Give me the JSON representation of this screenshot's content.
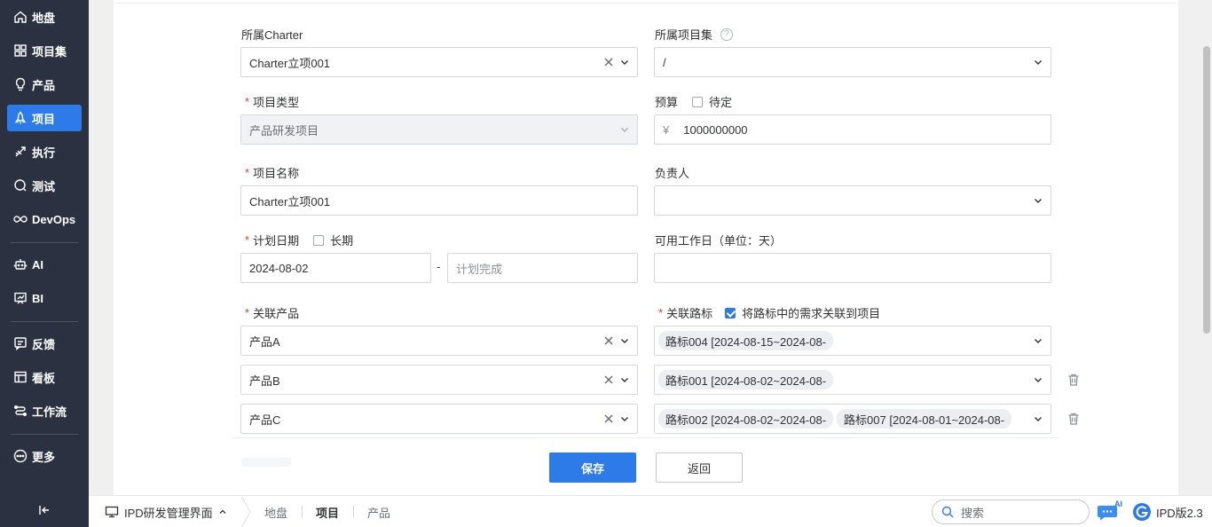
{
  "sidebar": {
    "items": [
      {
        "label": "地盘",
        "icon": "home-icon"
      },
      {
        "label": "项目集",
        "icon": "grid-icon"
      },
      {
        "label": "产品",
        "icon": "bulb-icon"
      },
      {
        "label": "项目",
        "icon": "rocket-icon",
        "active": true
      },
      {
        "label": "执行",
        "icon": "run-icon"
      },
      {
        "label": "测试",
        "icon": "test-icon"
      },
      {
        "label": "DevOps",
        "icon": "infinity-icon"
      },
      {
        "label": "AI",
        "icon": "robot-icon"
      },
      {
        "label": "BI",
        "icon": "chart-board-icon"
      },
      {
        "label": "反馈",
        "icon": "feedback-icon"
      },
      {
        "label": "看板",
        "icon": "kanban-icon"
      },
      {
        "label": "工作流",
        "icon": "workflow-icon"
      },
      {
        "label": "更多",
        "icon": "more-icon"
      }
    ],
    "collapse_icon": "collapse-left-icon"
  },
  "form": {
    "charter": {
      "label": "所属Charter",
      "value": "Charter立项001"
    },
    "program": {
      "label": "所属项目集",
      "value": "/"
    },
    "project_type": {
      "label": "项目类型",
      "value": "产品研发项目"
    },
    "budget": {
      "label": "预算",
      "tbd_label": "待定",
      "currency": "¥",
      "value": "1000000000"
    },
    "project_name": {
      "label": "项目名称",
      "value": "Charter立项001"
    },
    "owner": {
      "label": "负责人",
      "value": ""
    },
    "plan_date": {
      "label": "计划日期",
      "long_term_label": "长期",
      "start": "2024-08-02",
      "separator": "-",
      "end_placeholder": "计划完成"
    },
    "workdays": {
      "label": "可用工作日（单位：天）",
      "value": ""
    },
    "products": {
      "label": "关联产品",
      "values": [
        "产品A",
        "产品B",
        "产品C"
      ]
    },
    "milestones": {
      "label": "关联路标",
      "link_label": "将路标中的需求关联到项目",
      "link_checked": true,
      "rows": [
        [
          "路标004 [2024-08-15~2024-08-"
        ],
        [
          "路标001 [2024-08-02~2024-08-"
        ],
        [
          "路标002 [2024-08-02~2024-08-",
          "路标007 [2024-08-01~2024-08-"
        ]
      ]
    }
  },
  "actions": {
    "save": "保存",
    "back": "返回"
  },
  "bottombar": {
    "app_name": "IPD研发管理界面",
    "tabs": [
      {
        "label": "地盘",
        "active": false
      },
      {
        "label": "项目",
        "active": true
      },
      {
        "label": "产品",
        "active": false
      }
    ],
    "search_placeholder": "搜索",
    "ai_badge": "AI",
    "version": "IPD版2.3"
  },
  "colors": {
    "accent": "#2d7be8",
    "sidebar_bg": "#2b3140",
    "required": "#e0393e"
  }
}
